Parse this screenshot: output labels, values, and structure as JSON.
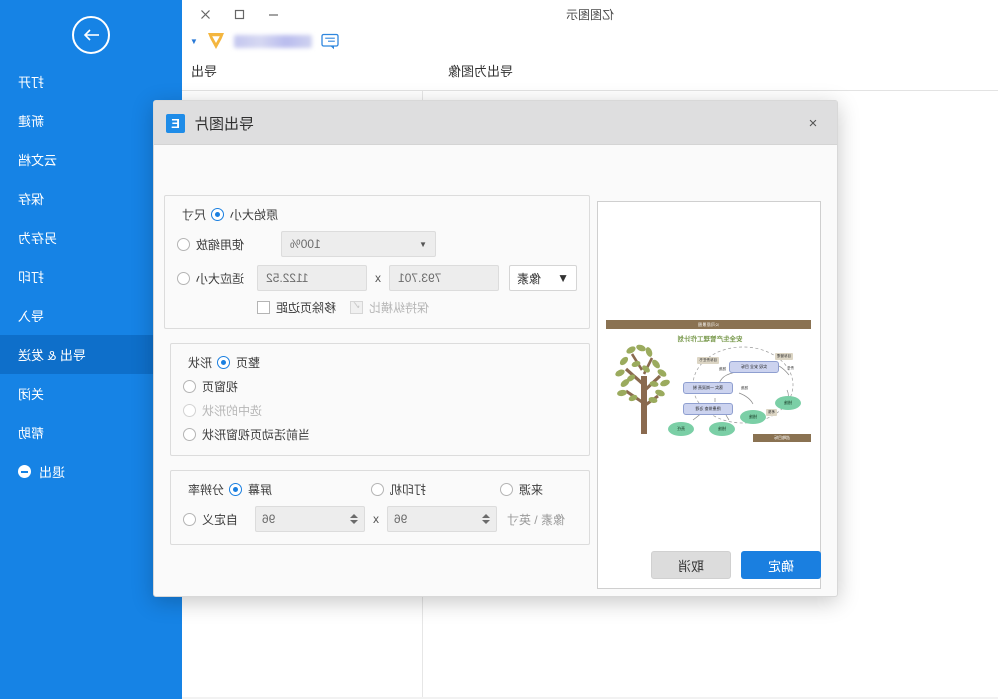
{
  "window": {
    "title": "亿图图示",
    "controls": {
      "minimize": "minimize",
      "maximize": "maximize",
      "close": "close"
    },
    "account": {
      "name_blurred": "",
      "vip_badge": "VIP",
      "feedback": "feedback"
    },
    "toolbar": {
      "export_as_image": "导出为图像",
      "export": "导出"
    }
  },
  "sidebar": {
    "back": "back-arrow",
    "items": [
      {
        "label": "打开",
        "active": false
      },
      {
        "label": "新建",
        "active": false
      },
      {
        "label": "云文档",
        "active": false
      },
      {
        "label": "保存",
        "active": false
      },
      {
        "label": "另存为",
        "active": false
      },
      {
        "label": "打印",
        "active": false
      },
      {
        "label": "导入",
        "active": false
      },
      {
        "label": "导出 & 发送",
        "active": true
      },
      {
        "label": "关闭",
        "active": false
      },
      {
        "label": "帮助",
        "active": false
      },
      {
        "label": "退出",
        "active": false
      }
    ]
  },
  "dialog": {
    "title": "导出图片",
    "logo_glyph": "E",
    "close": "×",
    "preview": {
      "band_top_text": "公司愿景图",
      "band_bottom_text": "战略目标",
      "title": "安全生产管理工作计划",
      "nodes": [
        {
          "text": "实现 安全 目标"
        },
        {
          "text": "落实 一岗双责 制"
        },
        {
          "text": "隐患排查 治理"
        }
      ],
      "ovals": [
        "措施",
        "措施",
        "措施",
        "责任"
      ],
      "labels": [
        "目标管理",
        "目标责任书",
        "责任",
        "措施",
        "措施",
        "考核"
      ]
    },
    "size_group": {
      "legend": "尺寸",
      "options": [
        {
          "label": "原始大小",
          "selected": true,
          "disabled": false
        },
        {
          "label": "使用缩放",
          "selected": false,
          "disabled": false
        },
        {
          "label": "适应大小",
          "selected": false,
          "disabled": false
        }
      ],
      "scale_value": "100%",
      "width_value": "1122.52",
      "height_value": "793.701",
      "dimension_separator": "x",
      "unit": "像素",
      "remove_margin_label": "移除页边距",
      "remove_margin_checked": false,
      "keep_ratio_label": "保持纵横比",
      "keep_ratio_checked": true,
      "keep_ratio_disabled": true
    },
    "shape_group": {
      "legend": "形状",
      "options": [
        {
          "label": "整页",
          "selected": true,
          "disabled": false
        },
        {
          "label": "视窗页",
          "selected": false,
          "disabled": false
        },
        {
          "label": "选中的形状",
          "selected": false,
          "disabled": true
        },
        {
          "label": "当前活动页视窗形状",
          "selected": false,
          "disabled": false
        }
      ]
    },
    "resolution_group": {
      "legend": "分辨率",
      "options": [
        {
          "label": "屏幕",
          "selected": true,
          "disabled": false
        },
        {
          "label": "打印机",
          "selected": false,
          "disabled": false
        },
        {
          "label": "来源",
          "selected": false,
          "disabled": false
        },
        {
          "label": "自定义",
          "selected": false,
          "disabled": false
        }
      ],
      "dpi_x": "96",
      "dpi_y": "96",
      "dimension_separator": "x",
      "unit_label": "像素 \\ 英寸"
    },
    "buttons": {
      "ok": "确定",
      "cancel": "取消"
    }
  },
  "colors": {
    "sidebar_blue": "#1683e5",
    "sidebar_active": "#0e6fca",
    "primary_button": "#1a7fe0",
    "dialog_header": "#dededf"
  }
}
